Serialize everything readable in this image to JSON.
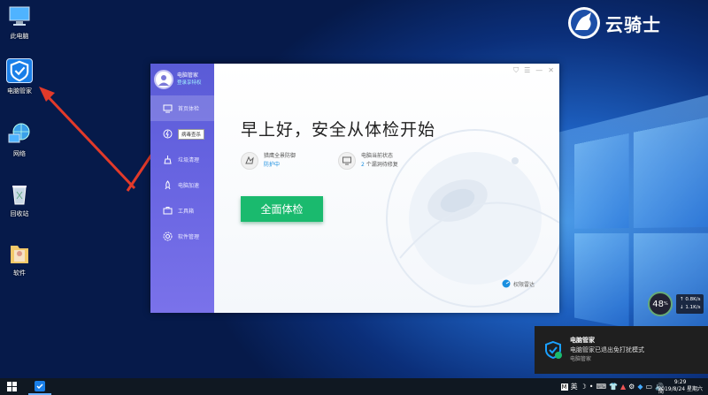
{
  "desktop": {
    "icons": [
      {
        "label": "此电脑",
        "icon": "computer-icon"
      },
      {
        "label": "电脑管家",
        "icon": "pc-manager-shield-icon"
      },
      {
        "label": "网络",
        "icon": "network-globe-icon"
      },
      {
        "label": "回收站",
        "icon": "recycle-bin-icon"
      },
      {
        "label": "软件",
        "icon": "software-folder-icon"
      }
    ],
    "watermark": "云骑士"
  },
  "app": {
    "user": {
      "name": "电脑管家",
      "sub": "登录享特权"
    },
    "nav": [
      {
        "label": "首页体检",
        "icon": "monitor-icon"
      },
      {
        "label": "病毒查杀",
        "icon": "lightning-shield-icon"
      },
      {
        "label": "垃圾清理",
        "icon": "broom-icon"
      },
      {
        "label": "电脑加速",
        "icon": "rocket-icon"
      },
      {
        "label": "工具箱",
        "icon": "toolbox-icon"
      },
      {
        "label": "软件管理",
        "icon": "software-manager-icon"
      }
    ],
    "greeting": "早上好，安全从体检开始",
    "status": [
      {
        "label": "猎鹰全景防御",
        "value": "防护中"
      },
      {
        "label": "电脑当前状态",
        "value_num": "2",
        "value_rest": "个漏洞待修复"
      }
    ],
    "scan_button": "全面体检",
    "permission": "权限雷达",
    "accent": "#1aba6e"
  },
  "speed_widget": {
    "percent": "48",
    "unit": "%",
    "up": "0.8K/s",
    "down": "1.1K/s"
  },
  "notification": {
    "title": "电脑管家",
    "body": "电脑管家已退出免打扰模式",
    "source": "电脑管家"
  },
  "tray": {
    "ime_main": "英",
    "ime_sub": "简"
  },
  "clock": {
    "time": "9:29",
    "date": "2019/8/24 星期六"
  }
}
